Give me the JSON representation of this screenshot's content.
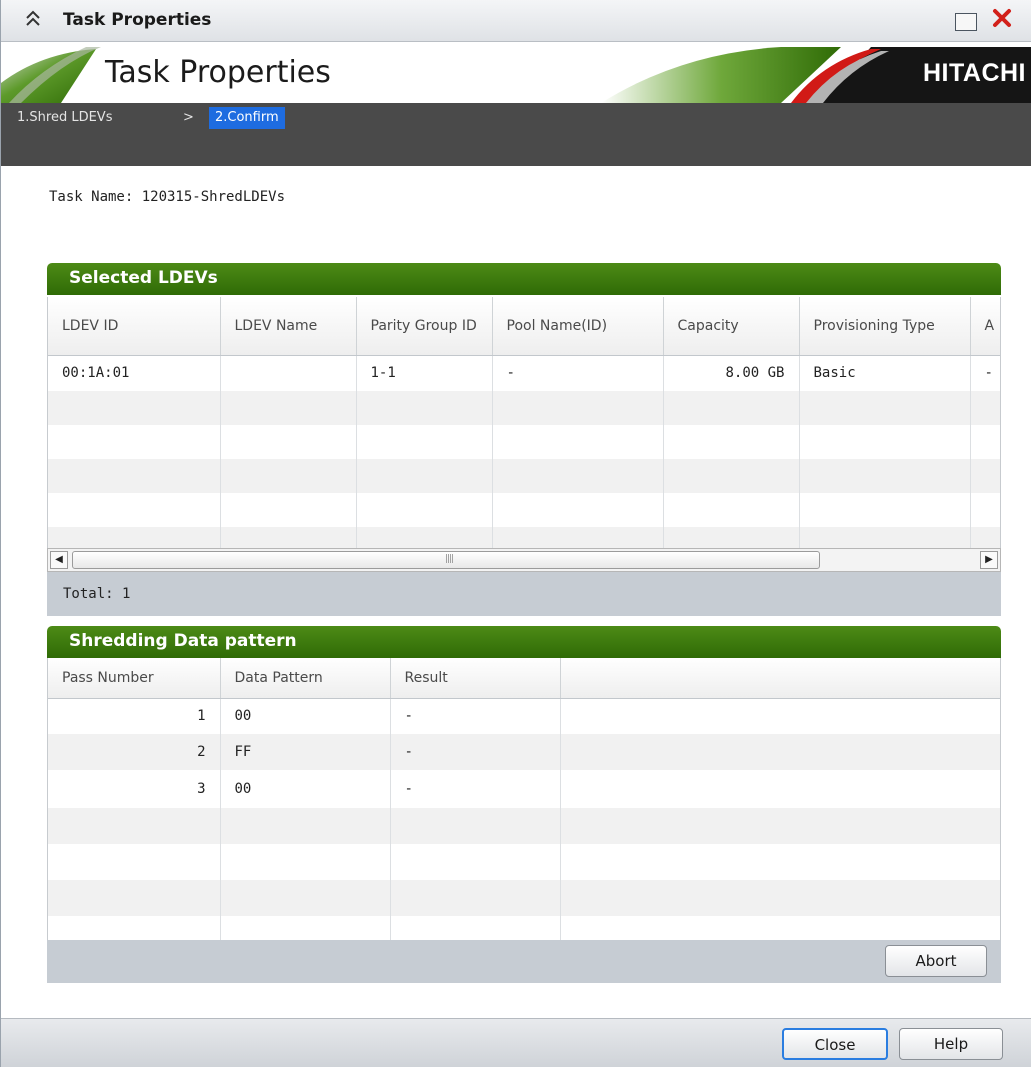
{
  "window": {
    "title": "Task Properties",
    "collapse_icon": "double-chevron-up-icon",
    "maximize_icon": "maximize-icon",
    "close_icon": "close-x-icon",
    "close_color": "#d2201a"
  },
  "banner": {
    "title": "Task Properties",
    "logo": "HITACHI",
    "accent_green": "#3a7d0c",
    "accent_red": "#d11a16"
  },
  "breadcrumb": {
    "step1": "1.Shred LDEVs",
    "separator": ">",
    "step2": "2.Confirm",
    "active_color": "#1e6ce0"
  },
  "task": {
    "label": "Task Name:",
    "value": "120315-ShredLDEVs",
    "text": "Task Name: 120315-ShredLDEVs"
  },
  "selected_ldevs": {
    "title": "Selected LDEVs",
    "columns": [
      "LDEV ID",
      "LDEV Name",
      "Parity Group ID",
      "Pool Name(ID)",
      "Capacity",
      "Provisioning Type",
      "A"
    ],
    "rows": [
      [
        "00:1A:01",
        "",
        "1-1",
        "-",
        "8.00 GB",
        "Basic",
        "-"
      ]
    ],
    "total_text": "Total:  1"
  },
  "shredding": {
    "title": "Shredding Data pattern",
    "columns": [
      "Pass Number",
      "Data Pattern",
      "Result",
      ""
    ],
    "rows": [
      [
        "1",
        "00",
        "-"
      ],
      [
        "2",
        "FF",
        "-"
      ],
      [
        "3",
        "00",
        "-"
      ]
    ],
    "abort_label": "Abort"
  },
  "footer": {
    "close_label": "Close",
    "help_label": "Help"
  }
}
